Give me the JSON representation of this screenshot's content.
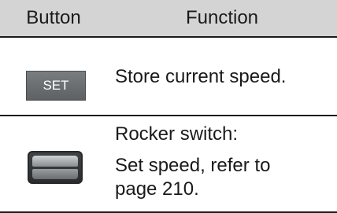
{
  "table": {
    "headers": {
      "button": "Button",
      "function": "Function"
    },
    "rows": [
      {
        "button_label": "SET",
        "description": "Store current speed."
      },
      {
        "button_icon": "rocker-switch",
        "title": "Rocker switch:",
        "description_line1": "Set speed, refer to",
        "description_line2": "page 210."
      }
    ]
  }
}
